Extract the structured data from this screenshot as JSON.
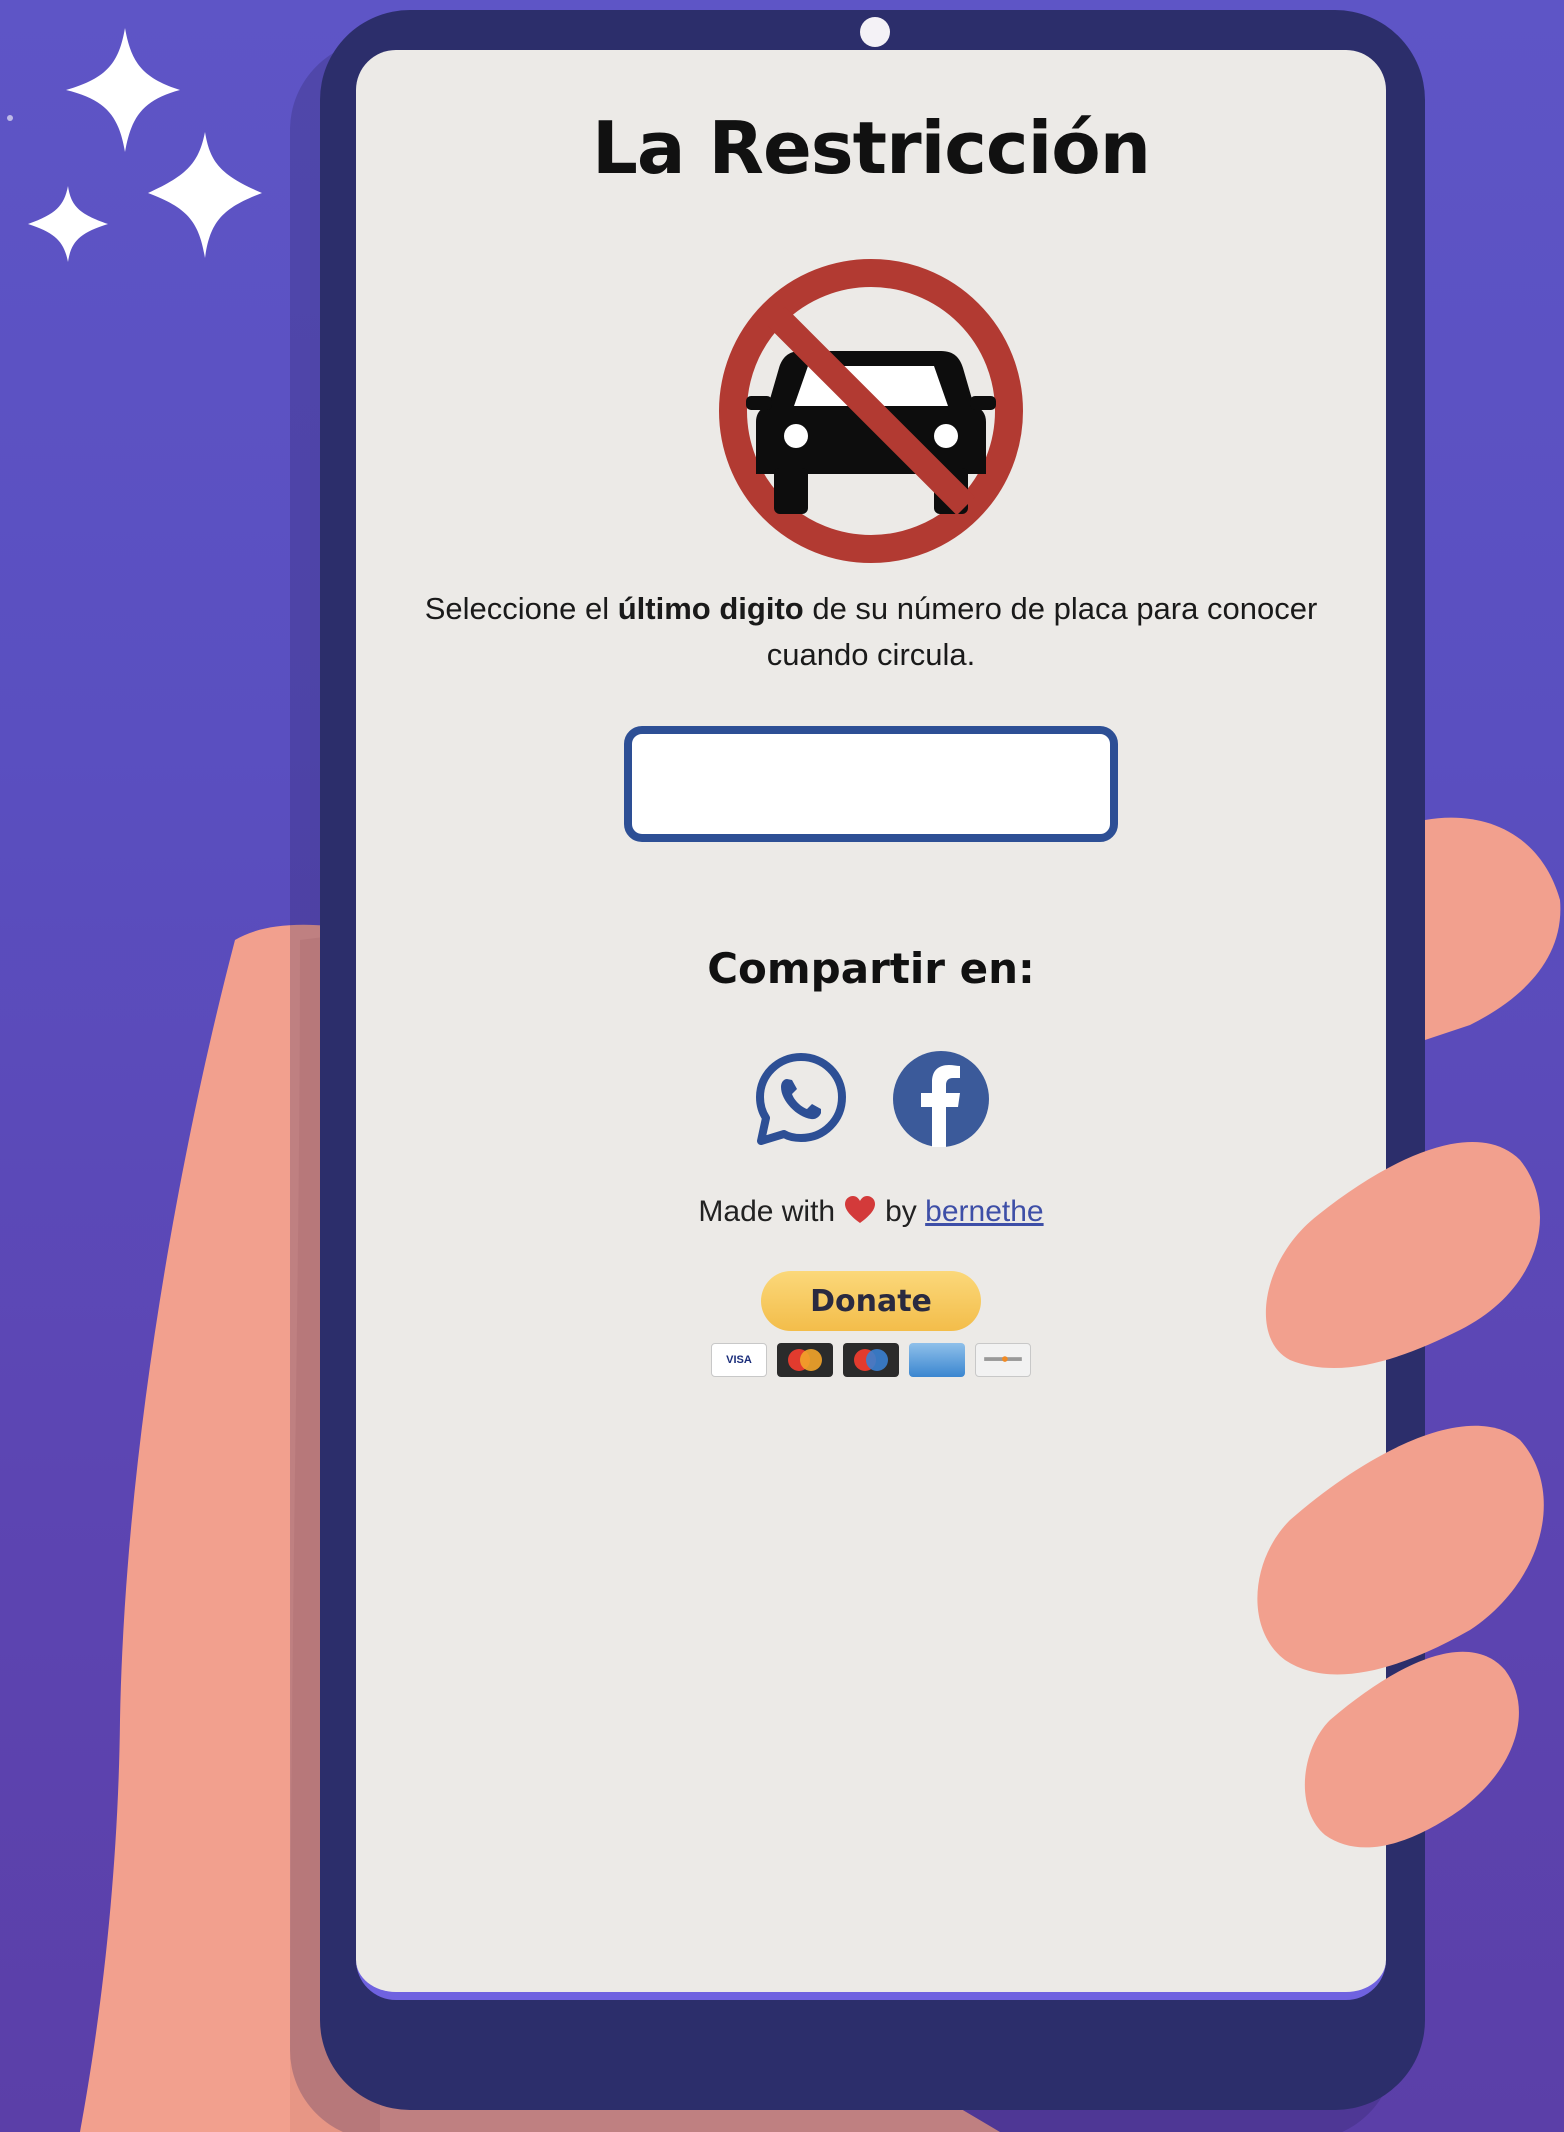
{
  "app": {
    "title": "La Restricción"
  },
  "instructions": {
    "prefix": "Seleccione el ",
    "bold": "último digito",
    "suffix": " de su número de placa para conocer cuando circula."
  },
  "plate_input": {
    "value": "",
    "placeholder": ""
  },
  "share": {
    "title": "Compartir en:",
    "icons": [
      "whatsapp-icon",
      "facebook-icon"
    ]
  },
  "footer": {
    "made_with": "Made with",
    "by": "by",
    "author": "bernethe"
  },
  "donate": {
    "label": "Donate",
    "cards": [
      "VISA",
      "mastercard",
      "maestro",
      "amex",
      "discover"
    ]
  },
  "colors": {
    "background": "#5a4fc0",
    "phone_frame": "#2c2e6b",
    "screen": "#eceae7",
    "input_border": "#2d4f95",
    "no_sign_red": "#b23a32",
    "facebook": "#3b5a9a",
    "whatsapp": "#2d4f95",
    "hand": "#f2a08e",
    "donate": "#f6c451",
    "link": "#3e4fa7"
  }
}
